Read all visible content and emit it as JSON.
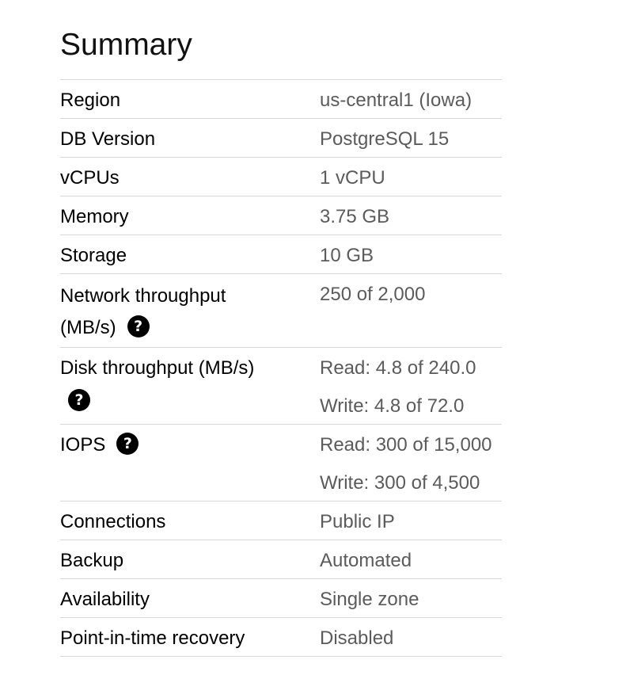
{
  "summary": {
    "title": "Summary",
    "help_glyph": "?",
    "rows": [
      {
        "key": "Region",
        "values": [
          "us-central1 (Iowa)"
        ]
      },
      {
        "key": "DB Version",
        "values": [
          "PostgreSQL 15"
        ]
      },
      {
        "key": "vCPUs",
        "values": [
          "1 vCPU"
        ]
      },
      {
        "key": "Memory",
        "values": [
          "3.75 GB"
        ]
      },
      {
        "key": "Storage",
        "values": [
          "10 GB"
        ]
      },
      {
        "key_line1": "Network throughput",
        "key_line2": "(MB/s)",
        "values": [
          "250 of 2,000"
        ]
      },
      {
        "key": "Disk throughput (MB/s)",
        "values": [
          "Read: 4.8 of 240.0",
          "Write: 4.8 of 72.0"
        ]
      },
      {
        "key": "IOPS",
        "values": [
          "Read: 300 of 15,000",
          "Write: 300 of 4,500"
        ]
      },
      {
        "key": "Connections",
        "values": [
          "Public IP"
        ]
      },
      {
        "key": "Backup",
        "values": [
          "Automated"
        ]
      },
      {
        "key": "Availability",
        "values": [
          "Single zone"
        ]
      },
      {
        "key": "Point-in-time recovery",
        "values": [
          "Disabled"
        ]
      }
    ]
  }
}
